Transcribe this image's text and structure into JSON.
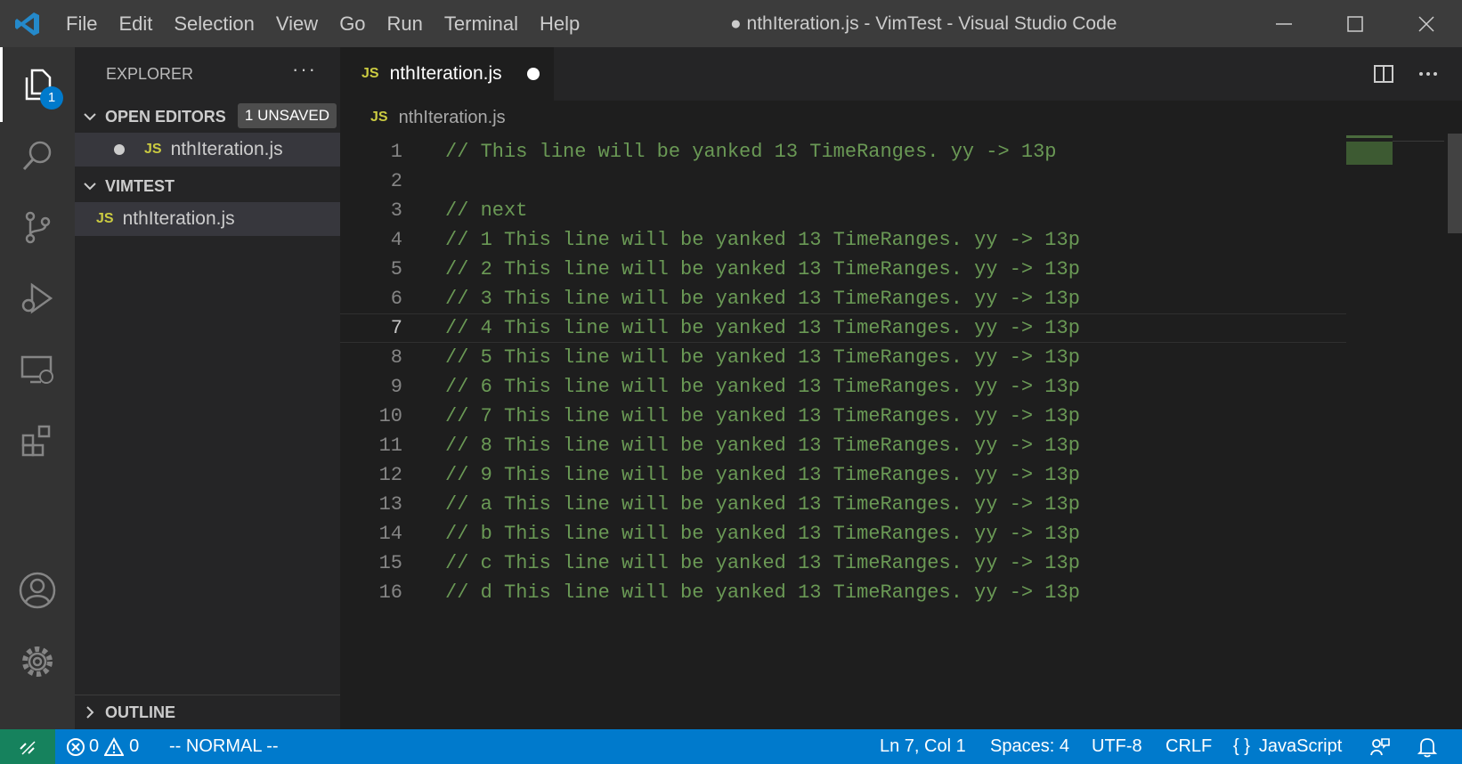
{
  "menu": [
    "File",
    "Edit",
    "Selection",
    "View",
    "Go",
    "Run",
    "Terminal",
    "Help"
  ],
  "window_title": "● nthIteration.js - VimTest - Visual Studio Code",
  "activity": {
    "explorer_badge": "1"
  },
  "sidebar": {
    "title": "EXPLORER",
    "more": "···",
    "open_editors": {
      "label": "OPEN EDITORS",
      "badge": "1 UNSAVED",
      "file": "nthIteration.js"
    },
    "folder": {
      "label": "VIMTEST",
      "file": "nthIteration.js"
    },
    "outline": "OUTLINE",
    "js_label": "JS"
  },
  "tab": {
    "label": "nthIteration.js",
    "js_label": "JS"
  },
  "breadcrumb": {
    "label": "nthIteration.js",
    "js_label": "JS"
  },
  "editor": {
    "current_line": 7,
    "lines": [
      "// This line will be yanked 13 TimeRanges. yy -> 13p",
      "",
      "// next",
      "// 1 This line will be yanked 13 TimeRanges. yy -> 13p",
      "// 2 This line will be yanked 13 TimeRanges. yy -> 13p",
      "// 3 This line will be yanked 13 TimeRanges. yy -> 13p",
      "// 4 This line will be yanked 13 TimeRanges. yy -> 13p",
      "// 5 This line will be yanked 13 TimeRanges. yy -> 13p",
      "// 6 This line will be yanked 13 TimeRanges. yy -> 13p",
      "// 7 This line will be yanked 13 TimeRanges. yy -> 13p",
      "// 8 This line will be yanked 13 TimeRanges. yy -> 13p",
      "// 9 This line will be yanked 13 TimeRanges. yy -> 13p",
      "// a This line will be yanked 13 TimeRanges. yy -> 13p",
      "// b This line will be yanked 13 TimeRanges. yy -> 13p",
      "// c This line will be yanked 13 TimeRanges. yy -> 13p",
      "// d This line will be yanked 13 TimeRanges. yy -> 13p"
    ]
  },
  "statusbar": {
    "errors": "0",
    "warnings": "0",
    "vim_mode": "-- NORMAL --",
    "position": "Ln 7, Col 1",
    "spaces": "Spaces: 4",
    "encoding": "UTF-8",
    "eol": "CRLF",
    "language": "JavaScript",
    "language_icon": "{ }"
  },
  "colors": {
    "comment": "#6a9955",
    "accent": "#007acc",
    "remote": "#16825d",
    "js": "#cbcb41"
  }
}
